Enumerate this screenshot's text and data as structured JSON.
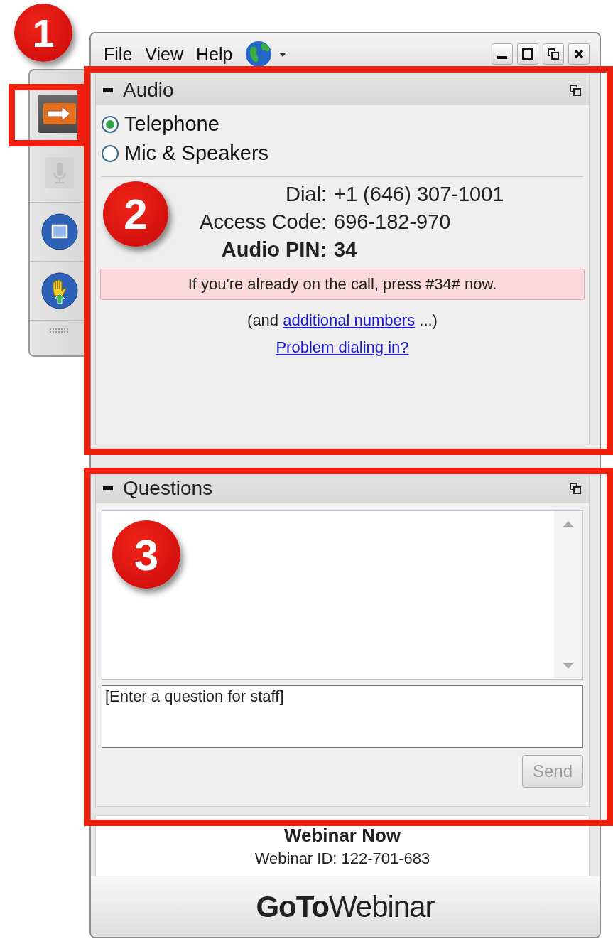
{
  "menu": [
    {
      "label": "File"
    },
    {
      "label": "View"
    },
    {
      "label": "Help"
    }
  ],
  "sidebar_tools": [
    {
      "kind": "arrow",
      "selected": true,
      "disabled": false
    },
    {
      "kind": "mic",
      "selected": false,
      "disabled": true
    },
    {
      "kind": "screen",
      "selected": false,
      "disabled": false
    },
    {
      "kind": "hand",
      "selected": false,
      "disabled": false
    }
  ],
  "audio_panel": {
    "title": "Audio",
    "options": [
      {
        "label": "Telephone",
        "selected": true
      },
      {
        "label": "Mic & Speakers",
        "selected": false
      }
    ],
    "details": [
      {
        "label": "Dial:",
        "value": "+1 (646) 307-1001",
        "bold": false
      },
      {
        "label": "Access Code:",
        "value": "696-182-970",
        "bold": false
      },
      {
        "label": "Audio PIN:",
        "value": "34",
        "bold": true
      }
    ],
    "alert": "If you're already on the call, press #34# now.",
    "more": {
      "before": "(and",
      "link": "additional numbers",
      "after": "...)"
    },
    "problem_link": "Problem dialing in?"
  },
  "questions_panel": {
    "title": "Questions",
    "input": {
      "value": "[Enter a question for staff]"
    },
    "send": {
      "label": "Send",
      "disabled": true
    }
  },
  "footer": {
    "title": "Webinar Now",
    "webinar_id": "Webinar ID: 122-701-683",
    "logo": "**GoTo**Webinar"
  },
  "annotations": [
    {
      "number": "1"
    },
    {
      "number": "2"
    },
    {
      "number": "3"
    }
  ]
}
